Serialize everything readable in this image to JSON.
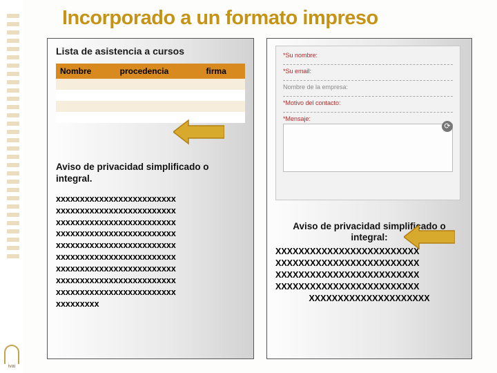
{
  "title": "Incorporado a un formato impreso",
  "left": {
    "subtitle": "Lista de asistencia a cursos",
    "table": {
      "headers": [
        "Nombre",
        "procedencia",
        "firma"
      ]
    },
    "caption": "Aviso de privacidad simplificado o integral.",
    "xlines": [
      "xxxxxxxxxxxxxxxxxxxxxxxxx",
      "xxxxxxxxxxxxxxxxxxxxxxxxx",
      "xxxxxxxxxxxxxxxxxxxxxxxxx",
      "xxxxxxxxxxxxxxxxxxxxxxxxx",
      "xxxxxxxxxxxxxxxxxxxxxxxxx",
      "xxxxxxxxxxxxxxxxxxxxxxxxx",
      "xxxxxxxxxxxxxxxxxxxxxxxxx",
      "xxxxxxxxxxxxxxxxxxxxxxxxx",
      "xxxxxxxxxxxxxxxxxxxxxxxxx",
      "xxxxxxxxx"
    ]
  },
  "right": {
    "form": {
      "fields": [
        {
          "label": "*Su nombre:",
          "required": true
        },
        {
          "label": "*Su email:",
          "required": true
        },
        {
          "label": "Nombre de la empresa:",
          "required": false
        },
        {
          "label": "*Motivo del contacto:",
          "required": true
        },
        {
          "label": "*Mensaje:",
          "required": true,
          "textarea": true
        }
      ]
    },
    "caption": "Aviso de privacidad simplificado o integral:",
    "xlines": [
      "XXXXXXXXXXXXXXXXXXXXXXXXX",
      "XXXXXXXXXXXXXXXXXXXXXXXXX",
      "XXXXXXXXXXXXXXXXXXXXXXXXX",
      "XXXXXXXXXXXXXXXXXXXXXXXXX",
      "XXXXXXXXXXXXXXXXXXXXX"
    ]
  },
  "logo_text": "ivai"
}
